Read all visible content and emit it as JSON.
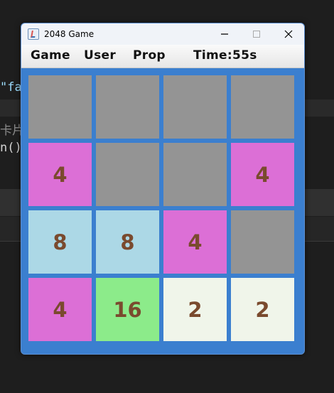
{
  "window": {
    "title": "2048 Game"
  },
  "menu": {
    "game": "Game",
    "user": "User",
    "prop": "Prop",
    "time": "Time:55s"
  },
  "editor_fragments": {
    "line1": "\"fa",
    "line2": "卡片",
    "line3": "n()"
  },
  "board": {
    "rows": [
      [
        "",
        "",
        "",
        ""
      ],
      [
        "4",
        "",
        "",
        "4"
      ],
      [
        "8",
        "8",
        "4",
        ""
      ],
      [
        "4",
        "16",
        "2",
        "2"
      ]
    ]
  },
  "colors": {
    "empty": "#949494",
    "tile_2": "#f0f5ea",
    "tile_4": "#dc6fd6",
    "tile_8": "#acd8e6",
    "tile_16": "#8ceb8a",
    "board_bg": "#3b7fcf",
    "number_text": "#7a4a2e"
  },
  "icons": {
    "app": "java-cup-icon",
    "minimize": "minimize-icon",
    "maximize": "maximize-icon",
    "close": "close-icon"
  }
}
